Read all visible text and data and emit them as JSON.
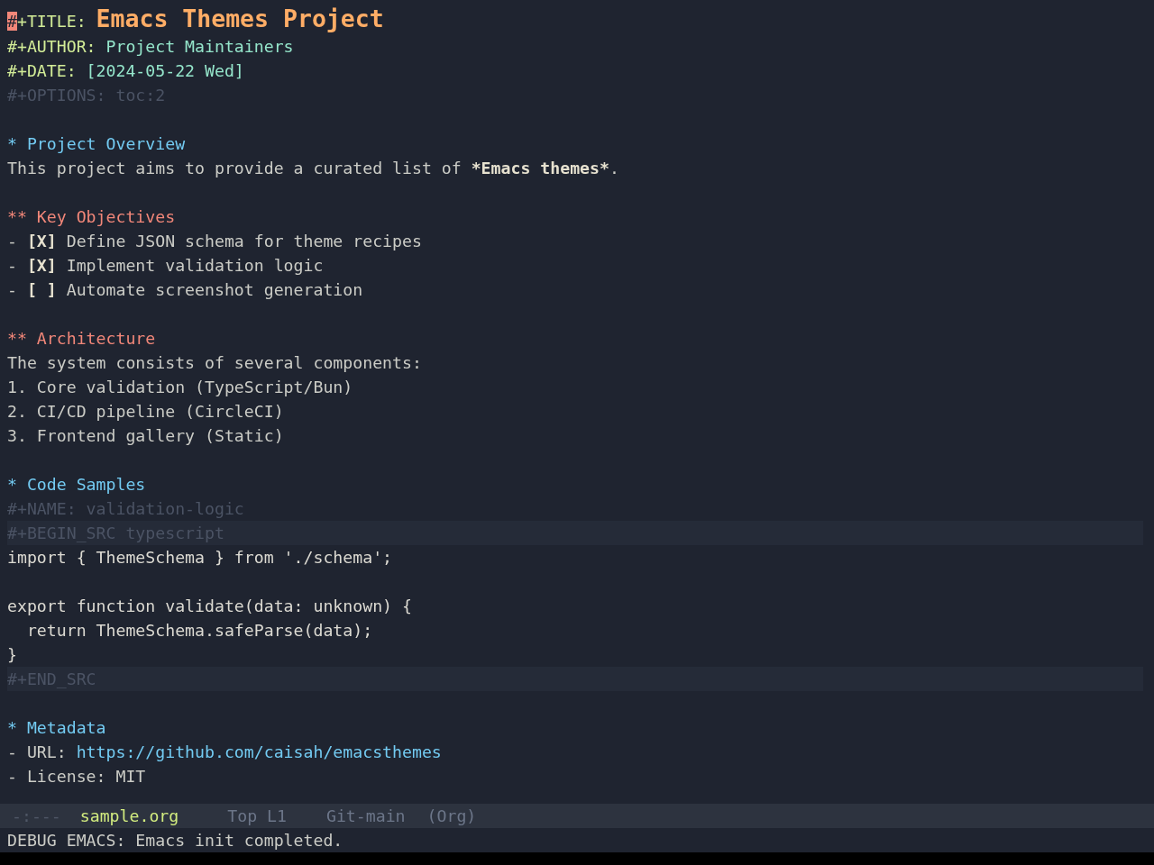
{
  "front_matter": [
    {
      "kind": "title",
      "keyword": "#+TITLE:",
      "value": "Emacs Themes Project",
      "cursor": true
    },
    {
      "kind": "keyword",
      "keyword": "#+AUTHOR:",
      "value": "Project Maintainers",
      "cursor": false
    },
    {
      "kind": "keyword",
      "keyword": "#+DATE:",
      "value": "[2024-05-22 Wed]",
      "cursor": false
    },
    {
      "kind": "meta",
      "text": "#+OPTIONS: toc:2",
      "cursor": false
    },
    {
      "kind": "blank"
    }
  ],
  "sections": [
    {
      "heading": "* Project Overview",
      "body": [
        {
          "kind": "paragraph",
          "segments": [
            {
              "text": "This project aims to provide a curated list of ",
              "bold": false
            },
            {
              "text": "*Emacs themes*",
              "bold": true
            },
            {
              "text": ".",
              "bold": false
            }
          ]
        },
        {
          "kind": "blank"
        }
      ],
      "children": [
        {
          "heading": "** Key Objectives",
          "body": [
            {
              "kind": "checklist",
              "bullet": "-",
              "checkbox": "[X]",
              "text": "Define JSON schema for theme recipes"
            },
            {
              "kind": "checklist",
              "bullet": "-",
              "checkbox": "[X]",
              "text": "Implement validation logic"
            },
            {
              "kind": "checklist",
              "bullet": "-",
              "checkbox": "[ ]",
              "text": "Automate screenshot generation"
            },
            {
              "kind": "blank"
            }
          ]
        },
        {
          "heading": "** Architecture",
          "body": [
            {
              "kind": "text",
              "text": "The system consists of several components:"
            },
            {
              "kind": "item",
              "text": "1. Core validation (TypeScript/Bun)"
            },
            {
              "kind": "item",
              "text": "2. CI/CD pipeline (CircleCI)"
            },
            {
              "kind": "item",
              "text": "3. Frontend gallery (Static)"
            },
            {
              "kind": "blank"
            }
          ]
        }
      ]
    },
    {
      "heading": "* Code Samples",
      "body": [
        {
          "kind": "meta",
          "text": "#+NAME: validation-logic",
          "cursor": false
        },
        {
          "kind": "block_begin",
          "text": "#+BEGIN_SRC typescript"
        },
        {
          "kind": "code",
          "text": "import { ThemeSchema } from './schema';"
        },
        {
          "kind": "blank"
        },
        {
          "kind": "code",
          "text": "export function validate(data: unknown) {"
        },
        {
          "kind": "code",
          "text": "  return ThemeSchema.safeParse(data);"
        },
        {
          "kind": "code",
          "text": "}"
        },
        {
          "kind": "block_end",
          "text": "#+END_SRC"
        },
        {
          "kind": "blank"
        }
      ]
    },
    {
      "heading": "* Metadata",
      "body": [
        {
          "kind": "link_item",
          "bullet": "-",
          "label": "URL:",
          "link": "https://github.com/caisah/emacsthemes"
        },
        {
          "kind": "item",
          "text": "- License: MIT"
        }
      ]
    }
  ],
  "mode_line": {
    "segments": [
      {
        "kind": "status",
        "text": "-:---"
      },
      {
        "kind": "buffer",
        "text": "sample.org"
      },
      {
        "kind": "position",
        "text": "Top L1"
      },
      {
        "kind": "vc",
        "text": "Git-main"
      },
      {
        "kind": "mode",
        "text": "(Org)"
      }
    ]
  },
  "echo_area": {
    "message": "DEBUG EMACS: Emacs init completed."
  }
}
